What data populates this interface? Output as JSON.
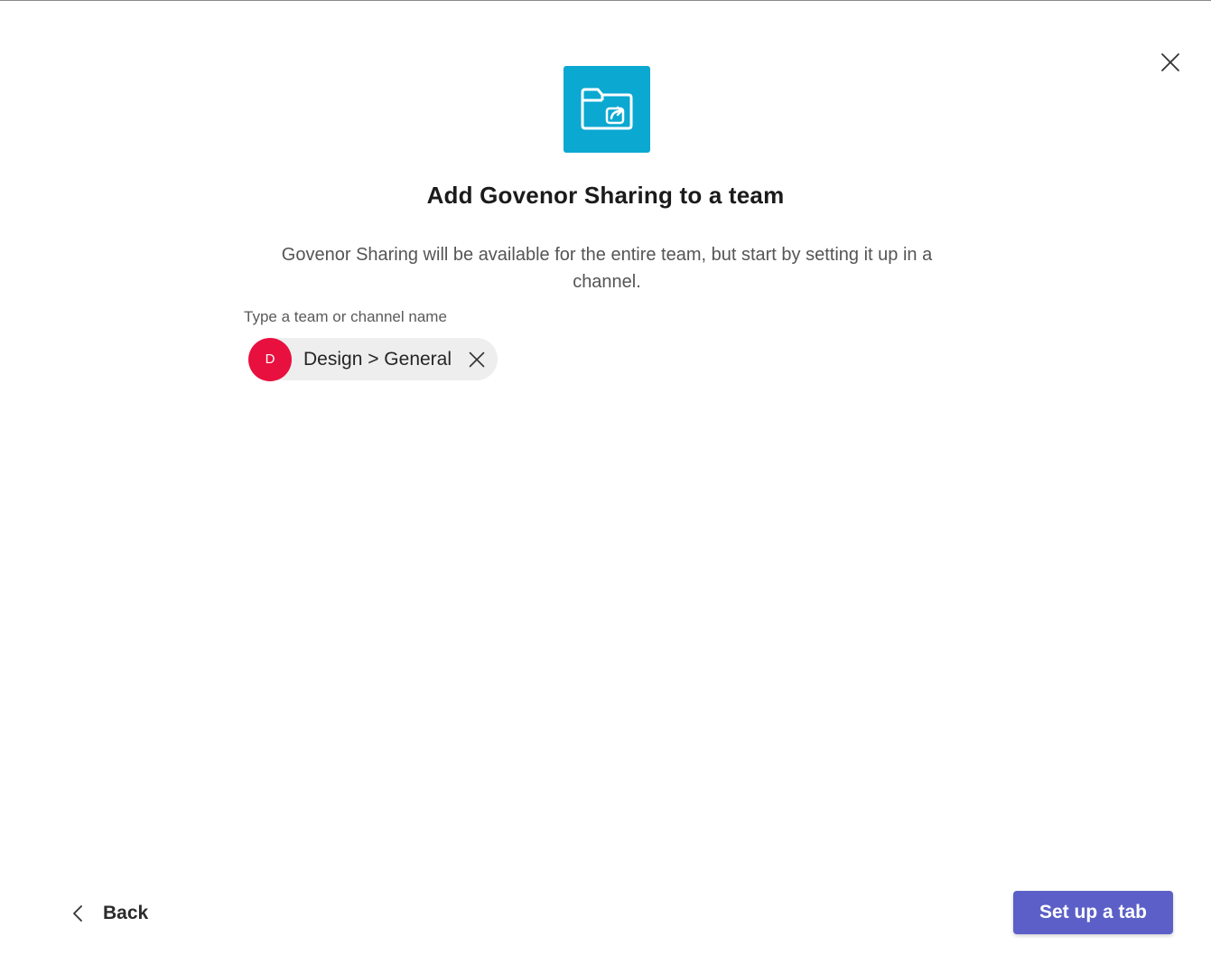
{
  "dialog": {
    "title": "Add Govenor Sharing to a team",
    "description": "Govenor Sharing will be available for the entire team, but start by setting it up in a channel."
  },
  "app_icon": {
    "icon": "folder-share-icon",
    "background_color": "#0ba8d1"
  },
  "channel_picker": {
    "label": "Type a team or channel name",
    "selected": {
      "avatar_initial": "D",
      "avatar_color": "#e8103f",
      "text": "Design > General"
    }
  },
  "footer": {
    "back_label": "Back",
    "primary_label": "Set up a tab",
    "primary_color": "#5b5fc7"
  }
}
